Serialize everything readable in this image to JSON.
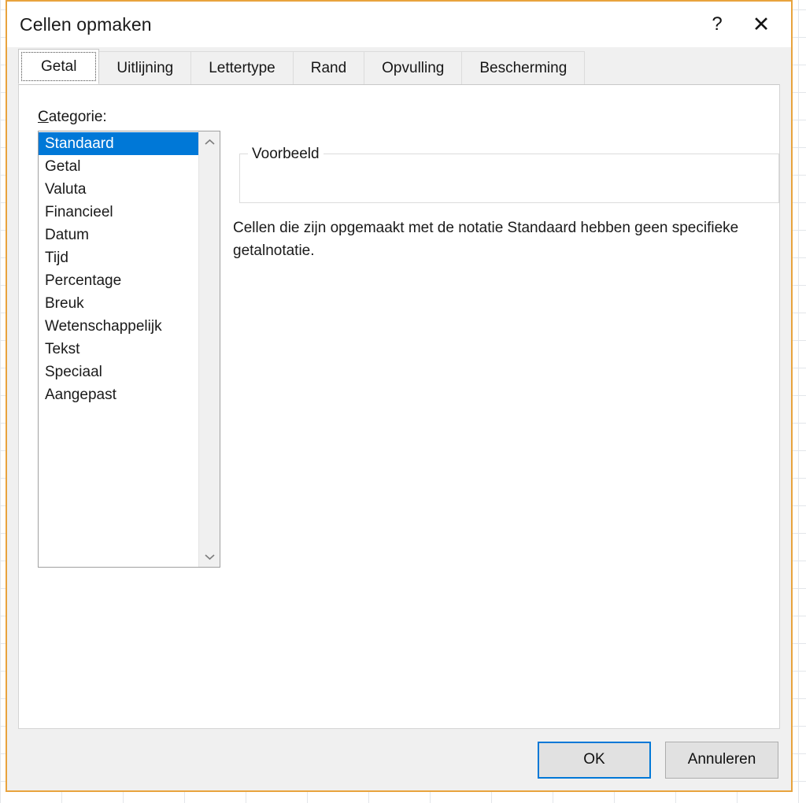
{
  "window": {
    "title": "Cellen opmaken",
    "help_icon": "question-mark-icon",
    "help_label": "?",
    "close_icon": "close-icon",
    "close_label": "✕",
    "border_color": "#e8a33d"
  },
  "tabs": [
    {
      "label": "Getal",
      "active": true
    },
    {
      "label": "Uitlijning",
      "active": false
    },
    {
      "label": "Lettertype",
      "active": false
    },
    {
      "label": "Rand",
      "active": false
    },
    {
      "label": "Opvulling",
      "active": false
    },
    {
      "label": "Bescherming",
      "active": false
    }
  ],
  "category": {
    "label_prefix": "",
    "label_accel": "C",
    "label_rest": "ategorie:",
    "items": [
      "Standaard",
      "Getal",
      "Valuta",
      "Financieel",
      "Datum",
      "Tijd",
      "Percentage",
      "Breuk",
      "Wetenschappelijk",
      "Tekst",
      "Speciaal",
      "Aangepast"
    ],
    "selected": "Standaard",
    "selected_index": 0,
    "selection_color": "#0078d7",
    "scroll_up_icon": "chevron-up-icon",
    "scroll_up_glyph": "⌃",
    "scroll_down_icon": "chevron-down-icon",
    "scroll_down_glyph": "⌄"
  },
  "preview": {
    "legend": "Voorbeeld",
    "value": ""
  },
  "description": "Cellen die zijn opgemaakt met de notatie Standaard hebben geen specifieke getalnotatie.",
  "footer": {
    "ok_label": "OK",
    "cancel_label": "Annuleren",
    "default_button_color": "#0078d7"
  }
}
